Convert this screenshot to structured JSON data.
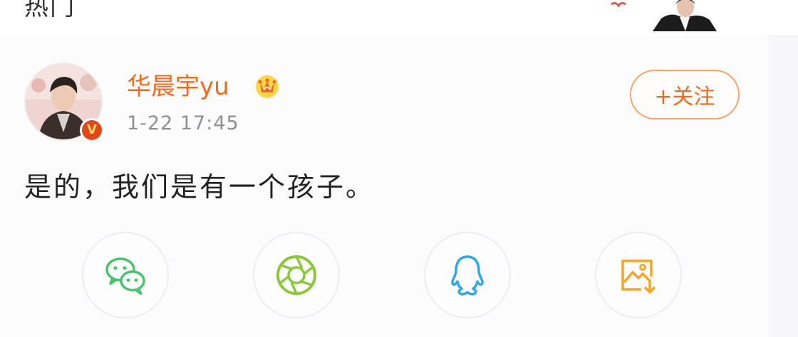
{
  "top_strip": {
    "tab_label": "热门"
  },
  "post": {
    "author": {
      "name": "华晨宇yu",
      "verified_badge": "V",
      "member_icon": "crown-icon"
    },
    "timestamp": "1-22 17:45",
    "follow_label": "+关注",
    "text": "是的，我们是有一个孩子。"
  },
  "share_options": [
    {
      "icon": "wechat-icon",
      "color": "#4cc26f"
    },
    {
      "icon": "moments-icon",
      "color": "#8dc63f"
    },
    {
      "icon": "qq-icon",
      "color": "#2fa7e8"
    },
    {
      "icon": "save-image-icon",
      "color": "#f5a623"
    }
  ],
  "colors": {
    "accent": "#f06b21",
    "verified": "#e0481c"
  }
}
